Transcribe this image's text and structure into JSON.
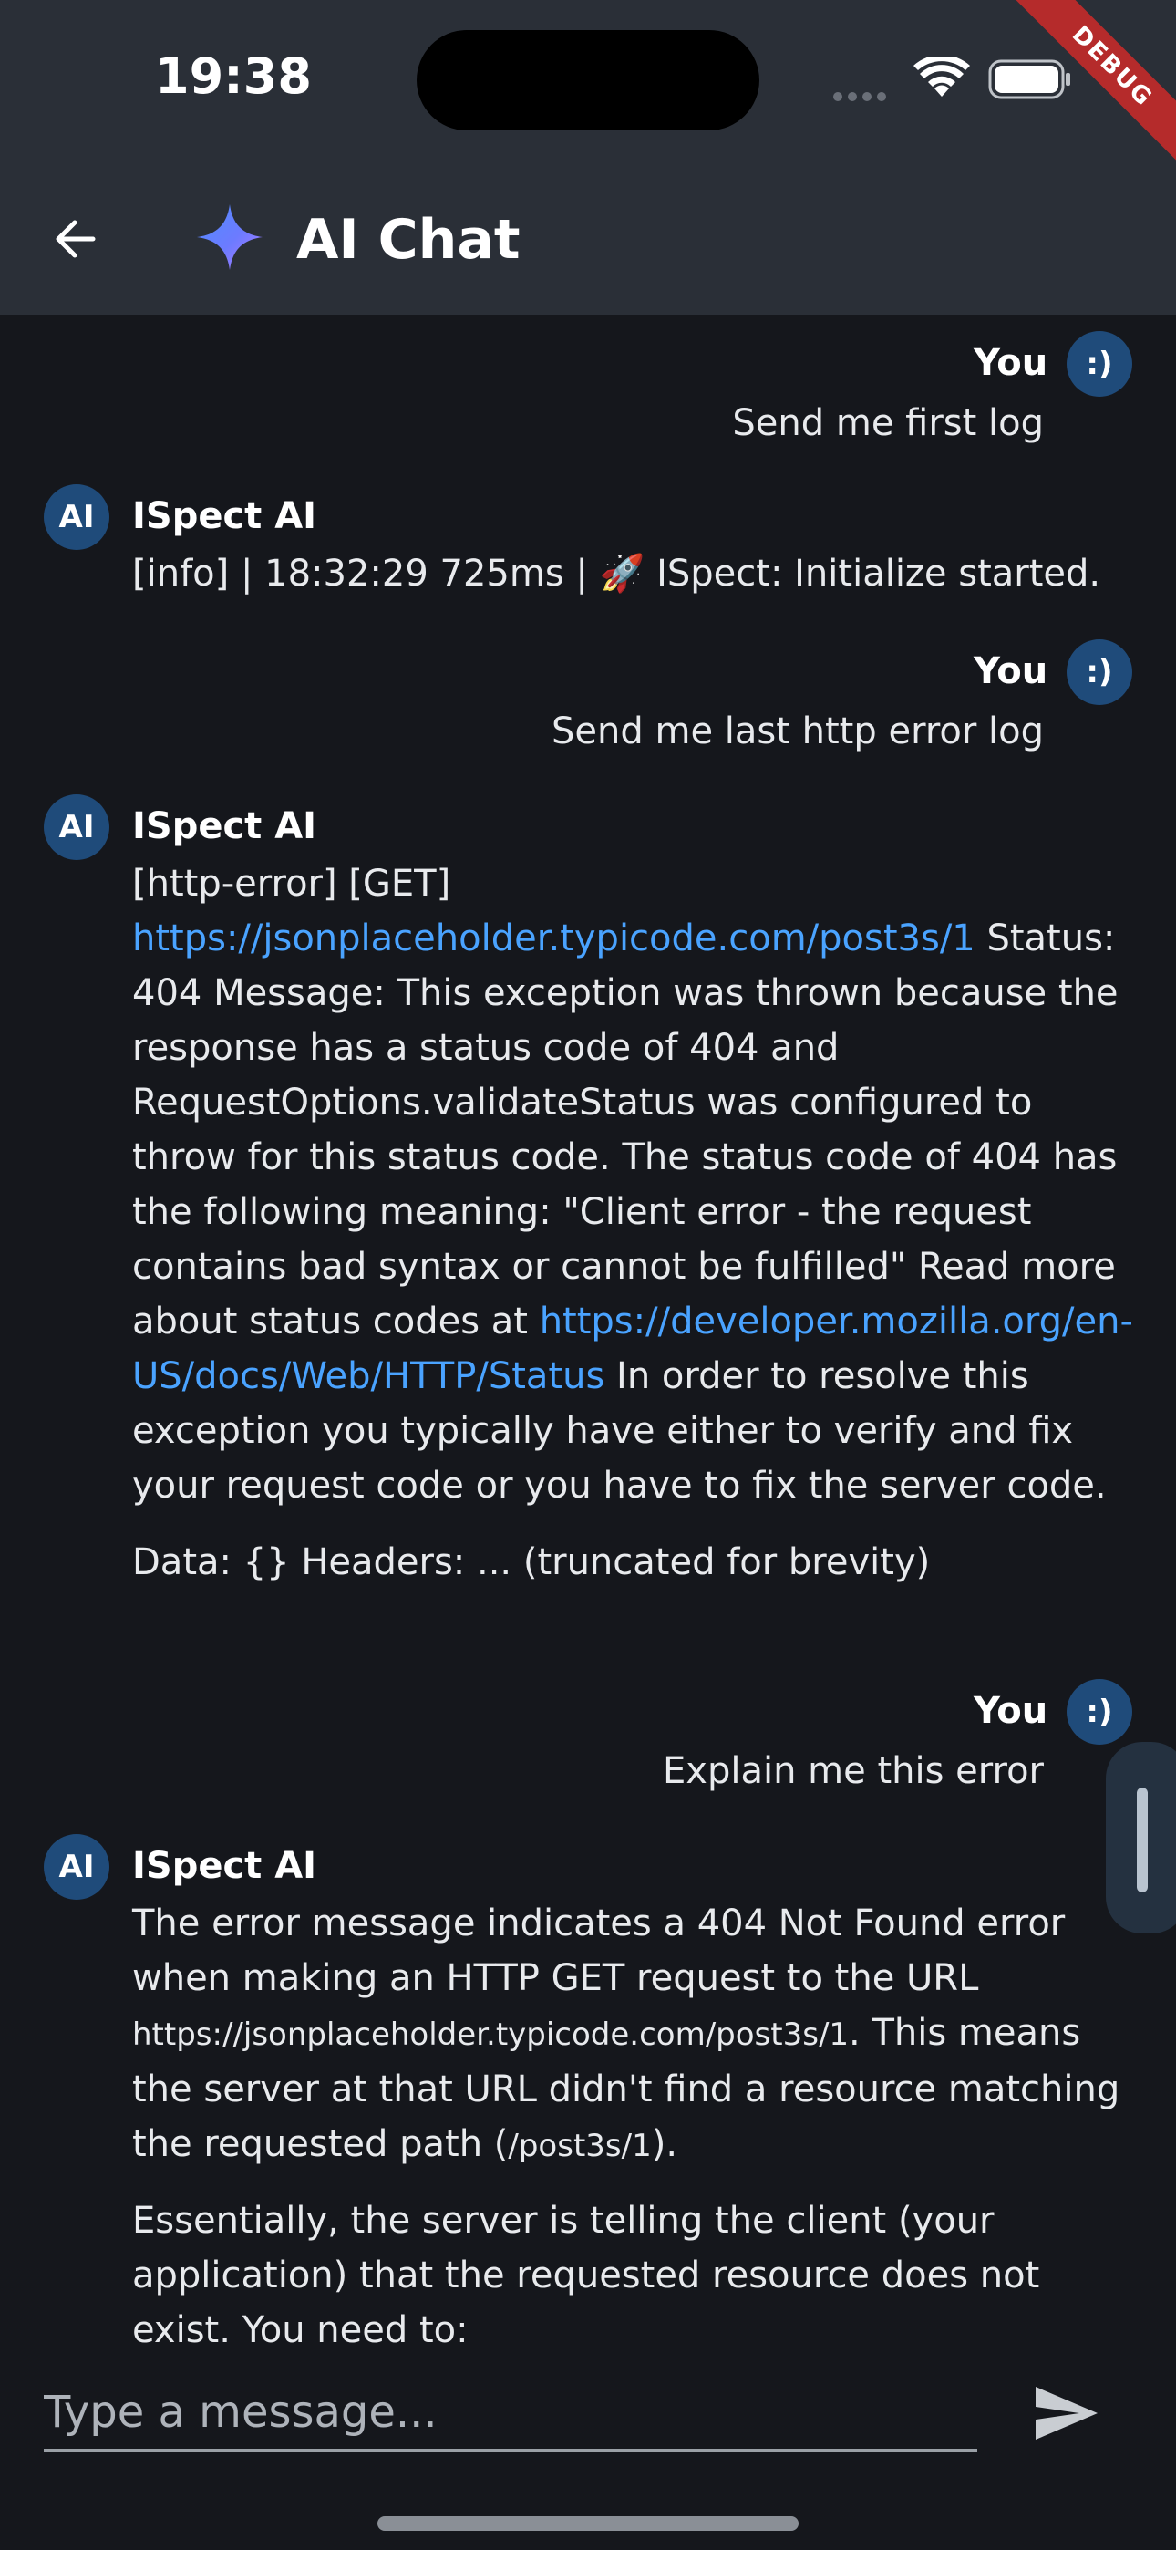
{
  "status_bar": {
    "time": "19:38",
    "debug_label": "DEBUG"
  },
  "app_bar": {
    "title": "AI Chat",
    "back_icon": "arrow-left-icon",
    "logo_icon": "sparkle-icon"
  },
  "messages": [
    {
      "sender": "You",
      "avatar": ":)",
      "text": "Send me first log"
    },
    {
      "sender": "ISpect AI",
      "avatar": "AI",
      "text": "[info] | 18:32:29 725ms | 🚀  ISpect: Initialize started."
    },
    {
      "sender": "You",
      "avatar": ":)",
      "text": "Send me last http error log"
    },
    {
      "sender": "ISpect AI",
      "avatar": "AI",
      "p1_prefix": "[http-error] [GET] ",
      "p1_link1": "https://jsonplaceholder.typicode.com/post3s/1",
      "p1_mid": " Status: 404 Message: This exception was thrown because the response has a status code of 404 and RequestOptions.validateStatus was configured to throw for this status code. The status code of 404 has the following meaning: \"Client error - the request contains bad syntax or cannot be fulfilled\" Read more about status codes at ",
      "p1_link2": "https://developer.mozilla.org/en-US/docs/Web/HTTP/Status",
      "p1_suffix": " In order to resolve this exception you typically have either to verify and fix your request code or you have to fix the server code.",
      "p2": "Data: {} Headers: ... (truncated for brevity)"
    },
    {
      "sender": "You",
      "avatar": ":)",
      "text": "Explain me this error"
    },
    {
      "sender": "ISpect AI",
      "avatar": "AI",
      "p1_a": "The error message indicates a 404 Not Found error when making an HTTP GET request to the URL ",
      "p1_code1": "https://jsonplaceholder.typicode.com/post3s/1",
      "p1_b": ".  This means the server at that URL didn't find a resource matching the requested path (",
      "p1_code2": "/post3s/1",
      "p1_c": ").",
      "p2": "Essentially, the server is telling the client (your application) that the requested resource does not exist.  You need to:"
    }
  ],
  "input": {
    "placeholder": "Type a message...",
    "value": ""
  },
  "colors": {
    "background": "#15171c",
    "app_bar": "#2a2f37",
    "avatar": "#1f4b7a",
    "link": "#4aa3ff"
  }
}
